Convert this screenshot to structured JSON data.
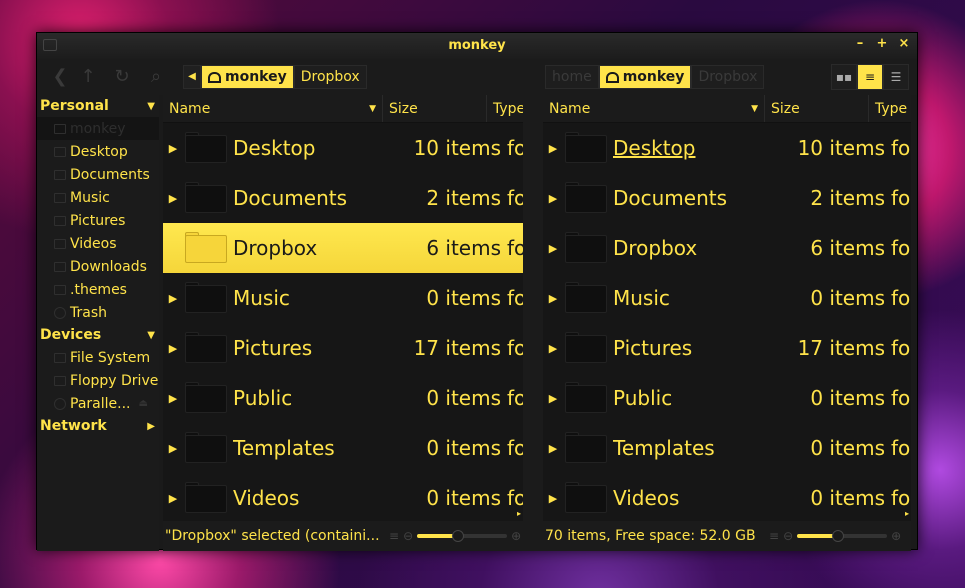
{
  "window": {
    "title": "monkey",
    "controls": {
      "minimize": "–",
      "maximize": "+",
      "close": "×"
    }
  },
  "toolbar": {
    "icons": [
      "back-icon",
      "up-icon",
      "reload-icon",
      "search-icon"
    ],
    "left_path": [
      {
        "label": "monkey",
        "active": true,
        "home": true
      },
      {
        "label": "Dropbox",
        "active": false,
        "home": false
      }
    ],
    "right_path": [
      {
        "label": "home",
        "active": false,
        "home": false,
        "dim": true
      },
      {
        "label": "monkey",
        "active": true,
        "home": true
      },
      {
        "label": "Dropbox",
        "active": false,
        "home": false,
        "dim": true
      }
    ],
    "view_buttons": [
      {
        "icon": "icon-view-icon",
        "glyph": "▪▪",
        "active": false
      },
      {
        "icon": "list-view-icon",
        "glyph": "≡",
        "active": true
      },
      {
        "icon": "compact-view-icon",
        "glyph": "☰",
        "active": false
      }
    ]
  },
  "sidebar": {
    "sections": [
      {
        "title": "Personal",
        "expanded": true,
        "items": [
          {
            "label": "monkey",
            "icon": "home-icon",
            "selected": true
          },
          {
            "label": "Desktop",
            "icon": "desktop-icon"
          },
          {
            "label": "Documents",
            "icon": "documents-icon"
          },
          {
            "label": "Music",
            "icon": "music-icon"
          },
          {
            "label": "Pictures",
            "icon": "pictures-icon"
          },
          {
            "label": "Videos",
            "icon": "videos-icon"
          },
          {
            "label": "Downloads",
            "icon": "downloads-icon"
          },
          {
            "label": ".themes",
            "icon": "folder-icon"
          },
          {
            "label": "Trash",
            "icon": "trash-icon"
          }
        ]
      },
      {
        "title": "Devices",
        "expanded": true,
        "items": [
          {
            "label": "File System",
            "icon": "drive-icon"
          },
          {
            "label": "Floppy Drive",
            "icon": "floppy-icon"
          },
          {
            "label": "Paralle...",
            "icon": "optical-drive-icon",
            "eject": true
          }
        ]
      },
      {
        "title": "Network",
        "expanded": false,
        "items": []
      }
    ]
  },
  "columns": {
    "name": "Name",
    "size": "Size",
    "type": "Type"
  },
  "left_pane": {
    "rows": [
      {
        "name": "Desktop",
        "size": "10 items",
        "type": "folder",
        "selected": false
      },
      {
        "name": "Documents",
        "size": "2 items",
        "type": "folder",
        "selected": false
      },
      {
        "name": "Dropbox",
        "size": "6 items",
        "type": "folder",
        "selected": true
      },
      {
        "name": "Music",
        "size": "0 items",
        "type": "folder",
        "selected": false
      },
      {
        "name": "Pictures",
        "size": "17 items",
        "type": "folder",
        "selected": false
      },
      {
        "name": "Public",
        "size": "0 items",
        "type": "folder",
        "selected": false
      },
      {
        "name": "Templates",
        "size": "0 items",
        "type": "folder",
        "selected": false
      },
      {
        "name": "Videos",
        "size": "0 items",
        "type": "folder",
        "selected": false
      }
    ],
    "status": "\"Dropbox\" selected (containi...",
    "zoom_level": 0.45
  },
  "right_pane": {
    "rows": [
      {
        "name": "Desktop",
        "size": "10 items",
        "type": "folder",
        "hover": true
      },
      {
        "name": "Documents",
        "size": "2 items",
        "type": "folder"
      },
      {
        "name": "Dropbox",
        "size": "6 items",
        "type": "folder"
      },
      {
        "name": "Music",
        "size": "0 items",
        "type": "folder"
      },
      {
        "name": "Pictures",
        "size": "17 items",
        "type": "folder"
      },
      {
        "name": "Public",
        "size": "0 items",
        "type": "folder"
      },
      {
        "name": "Templates",
        "size": "0 items",
        "type": "folder"
      },
      {
        "name": "Videos",
        "size": "0 items",
        "type": "folder"
      }
    ],
    "status": "70 items, Free space: 52.0 GB",
    "zoom_level": 0.45
  },
  "colors": {
    "accent": "#ffe34a",
    "background": "#1a1a1a",
    "selection": "#f8dd44"
  }
}
